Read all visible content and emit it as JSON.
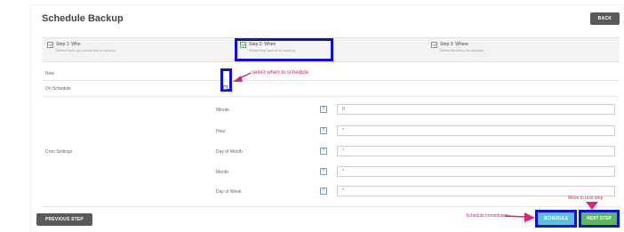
{
  "header": {
    "title": "Schedule Backup",
    "back_label": "BACK"
  },
  "steps": [
    {
      "title": "Step 1: Who",
      "subtitle": "Select users you would like to backup."
    },
    {
      "title": "Step 2: When",
      "subtitle": "Select time period for backup."
    },
    {
      "title": "Step 3: Where",
      "subtitle": "Select directory for backups."
    }
  ],
  "rows": {
    "now_label": "Now",
    "on_schedule_label": "On Schedule",
    "cron_label": "Cron Settings"
  },
  "cron_fields": [
    {
      "label": "Minute",
      "value": "0",
      "help": "?"
    },
    {
      "label": "Hour",
      "value": "*",
      "help": "?"
    },
    {
      "label": "Day of Month",
      "value": "*",
      "help": "?"
    },
    {
      "label": "Month",
      "value": "*",
      "help": "?"
    },
    {
      "label": "Day of Week",
      "value": "*",
      "help": "?"
    }
  ],
  "footer": {
    "previous_label": "PREVIOUS STEP",
    "schedule_label": "SCHEDULE",
    "next_label": "NEXT STEP"
  },
  "annotations": {
    "select_when": "select when to schedule",
    "schedule_immediately": "Schedule immediately",
    "move_next": "Move to next step"
  },
  "colors": {
    "annotation": "#e0246e",
    "highlight": "#1010d0",
    "schedule_button": "#5bc0de",
    "next_button": "#5cb85c",
    "dark_button": "#5a5a5a"
  }
}
